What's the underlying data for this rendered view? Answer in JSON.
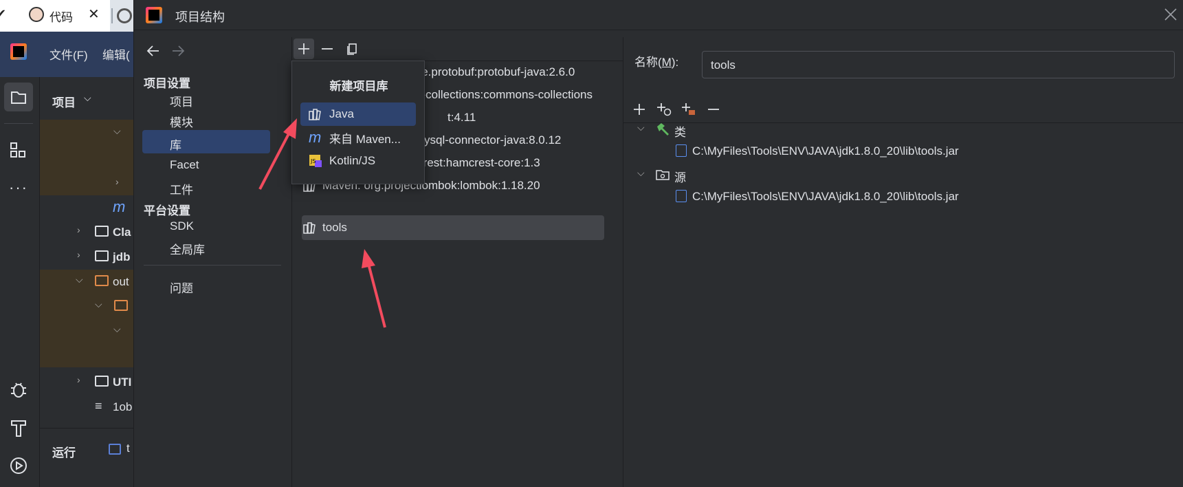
{
  "background": {
    "browser_tab_label": "代码",
    "ide_menu": [
      "文件(F)",
      "编辑("
    ],
    "project_label": "项目",
    "tree_items": [
      "Cla",
      "jdb",
      "out",
      "UTI",
      "1ob"
    ],
    "run_label": "运行",
    "run_tab_fragment": "t"
  },
  "dialog": {
    "title": "项目结构",
    "nav": {
      "project_settings_heading": "项目设置",
      "project_settings_items": [
        "项目",
        "模块",
        "库",
        "Facet",
        "工件"
      ],
      "platform_settings_heading": "平台设置",
      "platform_settings_items": [
        "SDK",
        "全局库"
      ],
      "problems": "问题",
      "selected": "库"
    },
    "libraries": [
      "gle.protobuf:protobuf-java:2.6.0",
      "s-collections:commons-collections",
      "t:4.11",
      "ysql-connector-java:8.0.12",
      "g       crest:hamcrest-core:1.3",
      "Maven: org.projectlombok:lombok:1.18.20",
      "tools"
    ],
    "selected_library": "tools",
    "popup": {
      "title": "新建项目库",
      "items": [
        {
          "label": "Java",
          "icon": "library-icon"
        },
        {
          "label": "来自 Maven...",
          "icon": "maven-icon"
        },
        {
          "label": "Kotlin/JS",
          "icon": "kotlin-js-icon"
        }
      ]
    },
    "detail": {
      "name_label": "名称(M):",
      "name_mnemonic": "M",
      "name_value": "tools",
      "tree": [
        {
          "label": "类",
          "icon": "hammer-icon",
          "path": "C:\\MyFiles\\Tools\\ENV\\JAVA\\jdk1.8.0_20\\lib\\tools.jar"
        },
        {
          "label": "源",
          "icon": "source-folder-icon",
          "path": "C:\\MyFiles\\Tools\\ENV\\JAVA\\jdk1.8.0_20\\lib\\tools.jar"
        }
      ]
    }
  },
  "colors": {
    "selection": "#2e436e",
    "row_selection": "#43454a",
    "annotation_arrow": "#f24b5e",
    "maven_blue": "#6fa4ff",
    "hammer_green": "#5fb85f"
  }
}
